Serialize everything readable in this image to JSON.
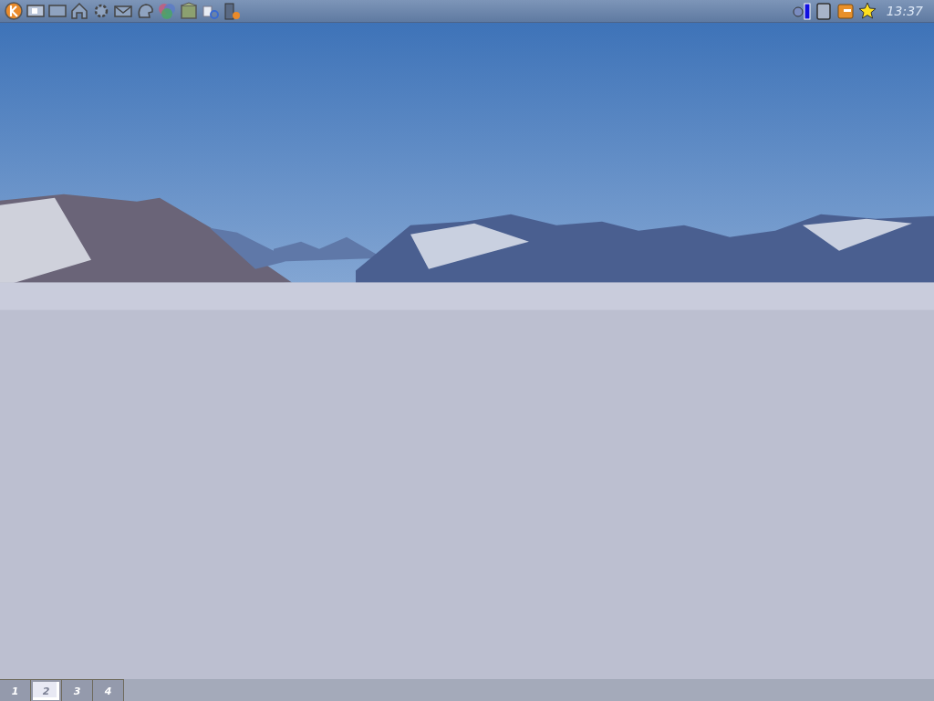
{
  "top_panel": {
    "clock": "13:37"
  },
  "pager": {
    "desktops": [
      {
        "label": "1",
        "selected": false
      },
      {
        "label": "2",
        "selected": true
      },
      {
        "label": "3",
        "selected": false
      },
      {
        "label": "4",
        "selected": false
      }
    ]
  }
}
